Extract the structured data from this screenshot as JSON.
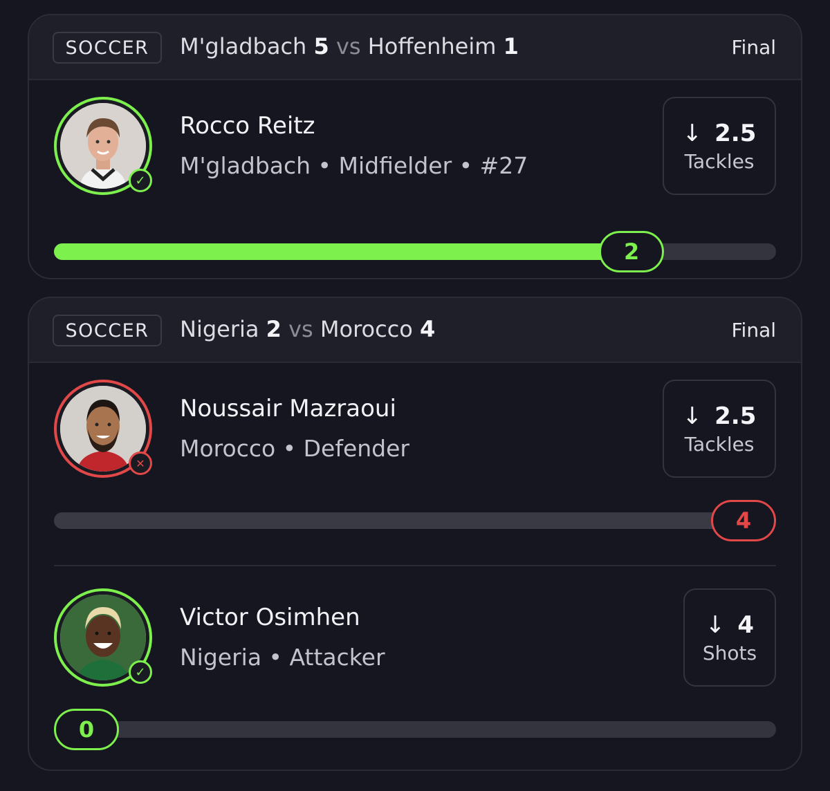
{
  "cards": [
    {
      "sport": "SOCCER",
      "home_team": "M'gladbach",
      "home_score": "5",
      "vs": "vs",
      "away_team": "Hoffenheim",
      "away_score": "1",
      "status": "Final",
      "players": [
        {
          "name": "Rocco Reitz",
          "meta": "M'gladbach • Midfielder • #27",
          "direction": "↓",
          "line": "2.5",
          "stat": "Tackles",
          "actual": "2",
          "progress_fraction": 0.8,
          "result": "win",
          "result_icon": "check-icon"
        }
      ]
    },
    {
      "sport": "SOCCER",
      "home_team": "Nigeria",
      "home_score": "2",
      "vs": "vs",
      "away_team": "Morocco",
      "away_score": "4",
      "status": "Final",
      "players": [
        {
          "name": "Noussair Mazraoui",
          "meta": "Morocco • Defender",
          "direction": "↓",
          "line": "2.5",
          "stat": "Tackles",
          "actual": "4",
          "progress_fraction": 1.0,
          "result": "loss",
          "result_icon": "x-icon"
        },
        {
          "name": "Victor Osimhen",
          "meta": "Nigeria • Attacker",
          "direction": "↓",
          "line": "4",
          "stat": "Shots",
          "actual": "0",
          "progress_fraction": 0.0,
          "result": "win",
          "result_icon": "check-icon"
        }
      ]
    }
  ],
  "colors": {
    "win": "#7df04d",
    "loss": "#e24848",
    "background": "#161620",
    "track": "#34343f"
  }
}
